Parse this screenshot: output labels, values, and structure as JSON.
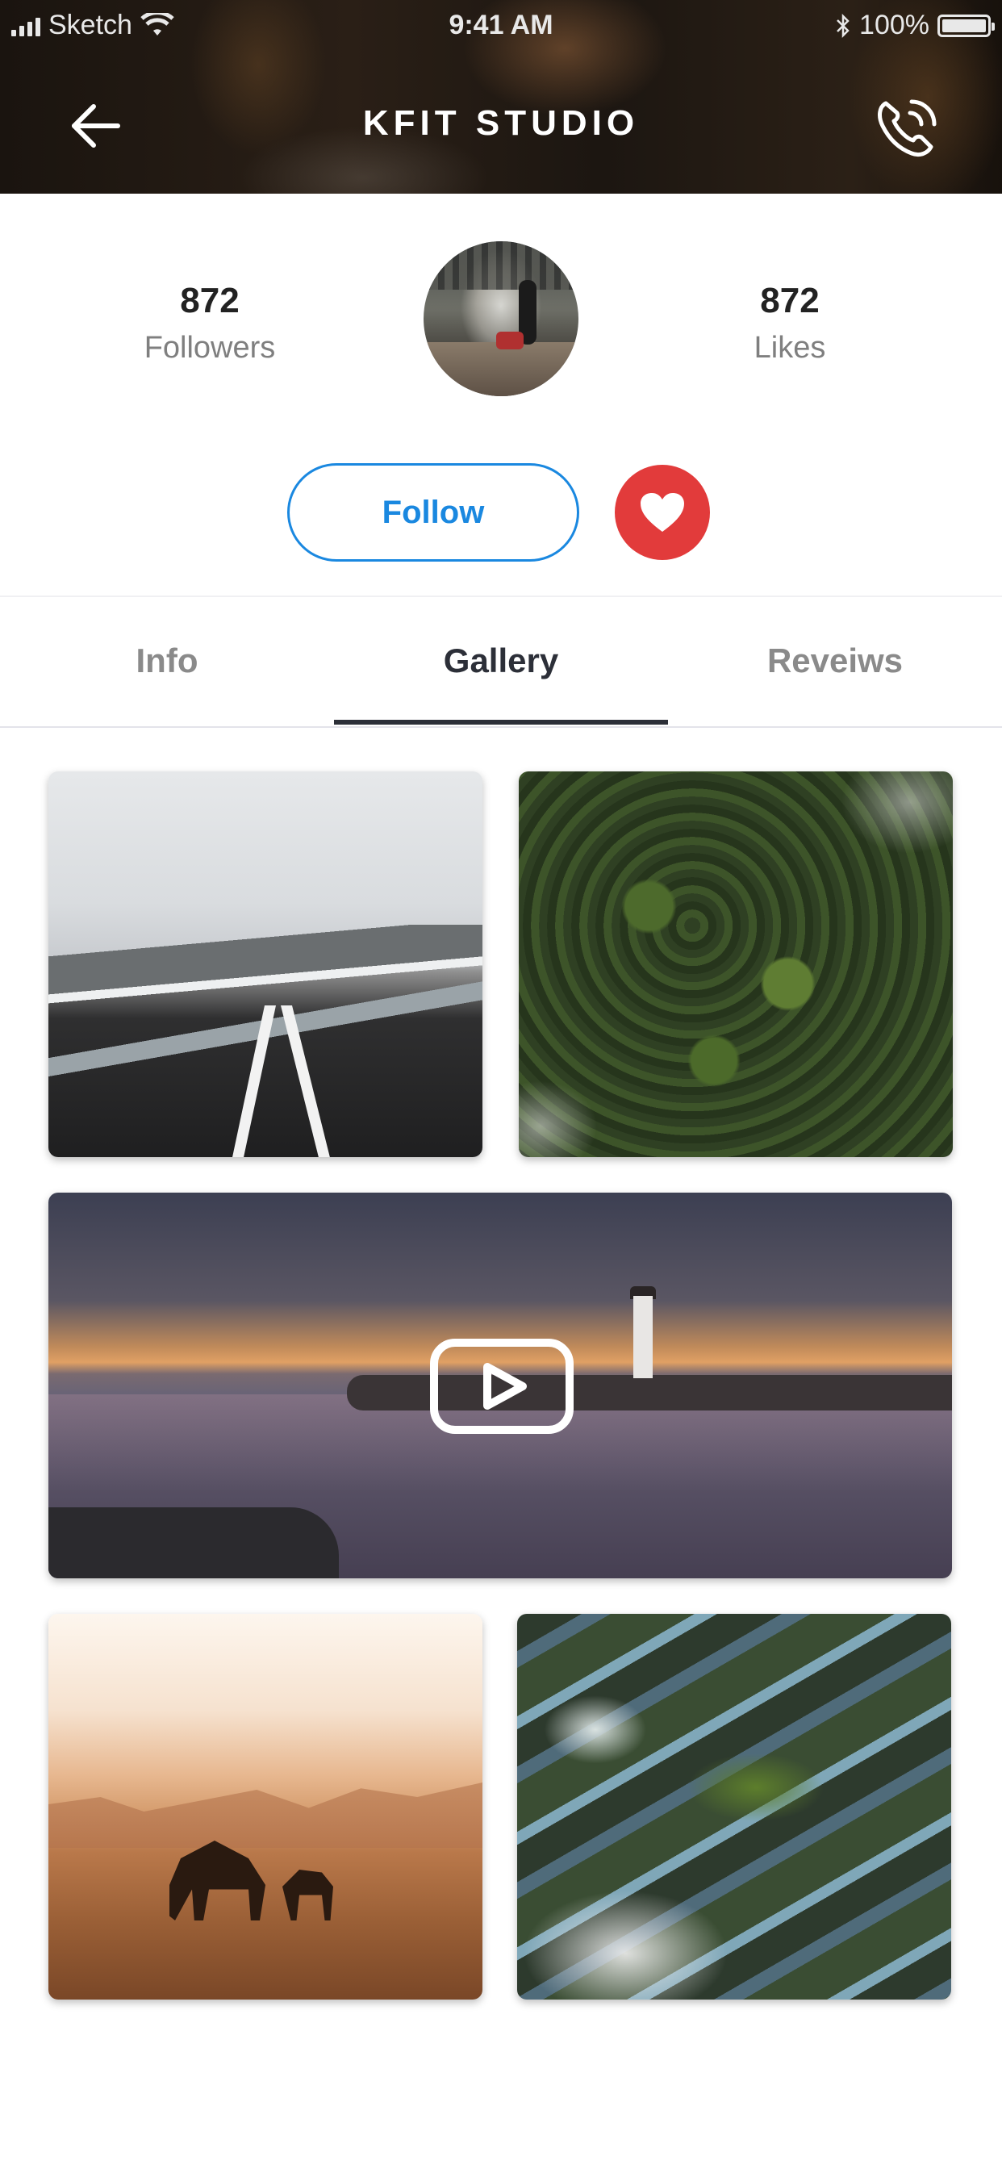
{
  "status_bar": {
    "carrier": "Sketch",
    "time": "9:41 AM",
    "battery": "100%"
  },
  "header": {
    "title": "KFIT STUDIO",
    "back_icon": "arrow-left-icon",
    "call_icon": "phone-call-icon"
  },
  "profile": {
    "followers_count": "872",
    "followers_label": "Followers",
    "likes_count": "872",
    "likes_label": "Likes",
    "follow_label": "Follow",
    "like_icon": "heart-icon"
  },
  "tabs": [
    {
      "label": "Info",
      "active": false
    },
    {
      "label": "Gallery",
      "active": true
    },
    {
      "label": "Reveiws",
      "active": false
    }
  ],
  "colors": {
    "accent_blue": "#1a88e0",
    "like_red": "#e23b3b",
    "tab_active": "#2c2f38",
    "tab_inactive": "#8a8a8a"
  },
  "gallery": {
    "video_icon": "play-video-icon"
  }
}
